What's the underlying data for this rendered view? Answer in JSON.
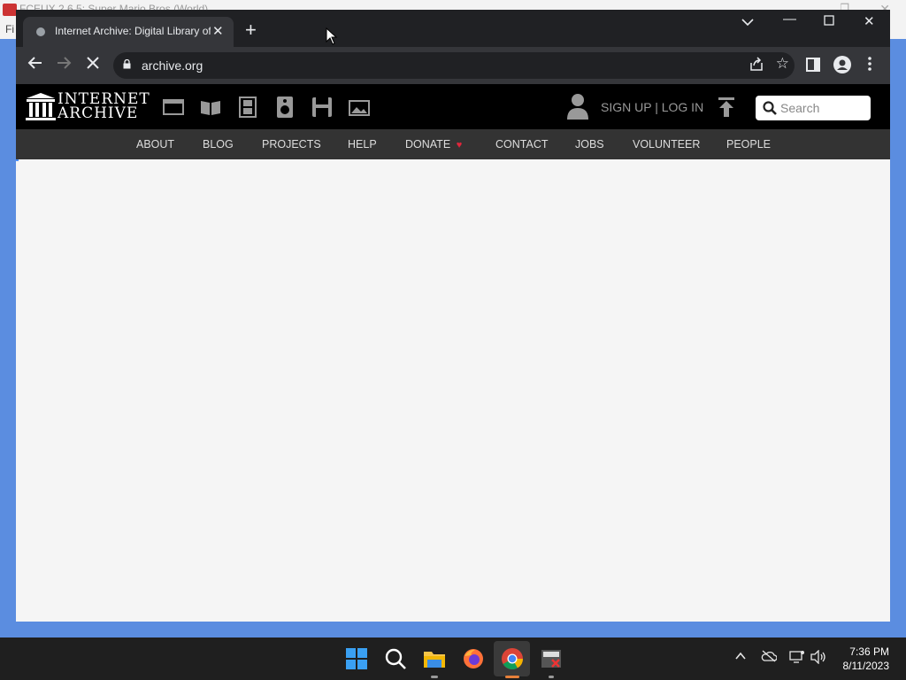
{
  "background_window": {
    "title": "FCEUX 2.6.5: Super Mario Bros (World)",
    "menu_hint": "Fi"
  },
  "browser": {
    "tab": {
      "title": "Internet Archive: Digital Library of Free & Borrowable Books, Movies, Music & Wayback Machine"
    },
    "address": "archive.org"
  },
  "site": {
    "logo": {
      "line1": "INTERNET",
      "line2": "ARCHIVE"
    },
    "auth_link": "SIGN UP | LOG IN",
    "search_placeholder": "Search",
    "nav": [
      "ABOUT",
      "BLOG",
      "PROJECTS",
      "HELP",
      "DONATE",
      "CONTACT",
      "JOBS",
      "VOLUNTEER",
      "PEOPLE"
    ]
  },
  "taskbar": {
    "time": "7:36 PM",
    "date": "8/11/2023"
  },
  "colors": {
    "desktop": "#5b8de0",
    "chrome_dark": "#202124",
    "chrome_toolbar": "#35363a",
    "ia_header": "#000000",
    "ia_nav": "#333333",
    "donate_heart": "#e0263b",
    "taskbar": "#1f1f1f"
  }
}
